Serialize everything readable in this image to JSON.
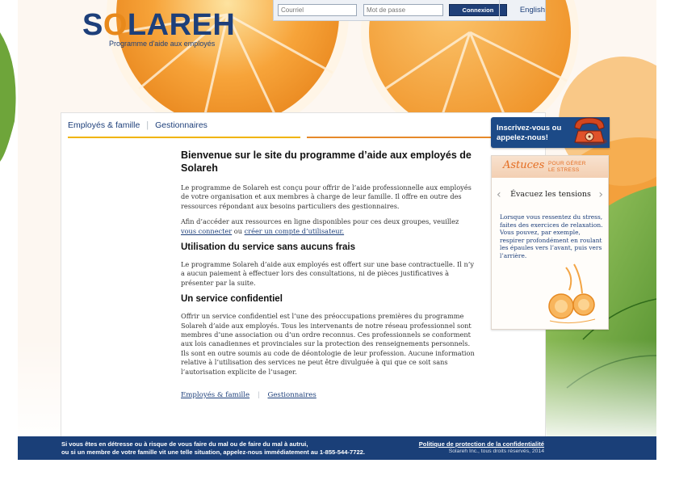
{
  "brand": {
    "logo_name": "SOLAREH",
    "logo_first": "S",
    "logo_o": "O",
    "logo_rest": "LAREH",
    "tagline": "Programme d'aide aux employés"
  },
  "login": {
    "email_placeholder": "Courriel",
    "password_placeholder": "Mot de passe",
    "submit_label": "Connexion",
    "language_label": "English"
  },
  "nav": {
    "items": [
      "Employés & famille",
      "Gestionnaires"
    ]
  },
  "content": {
    "title": "Bienvenue sur le site du programme d’aide aux employés de Solareh",
    "intro": "Le programme de Solareh est conçu pour offrir de l’aide professionnelle aux employés de votre organisation et aux membres à charge de leur famille. Il offre en outre des ressources répondant aux besoins particuliers des gestionnaires.",
    "access_text": "Afin d’accéder aux ressources en ligne disponibles pour ces deux groupes, veuillez",
    "login_link": "vous connecter",
    "or_text": " ou ",
    "register_link": "créer un compte d’utilisateur.",
    "section1_title": "Utilisation du service sans aucuns frais",
    "section1_text": "Le programme Solareh d’aide aux employés est offert sur une base contractuelle. Il n’y a aucun paiement à effectuer lors des consultations, ni de pièces justificatives à présenter par la suite.",
    "section2_title": "Un service confidentiel",
    "section2_text": "Offrir un service confidentiel est l’une des préoccupations premières du programme Solareh d’aide aux employés. Tous les intervenants de notre réseau professionnel sont membres d’une association ou d’un ordre reconnus. Ces professionnels se conforment aux lois canadiennes et provinciales sur la protection des renseignements personnels. Ils sont en outre soumis au code de déontologie de leur profession. Aucune information relative à l’utilisation des services ne peut être divulguée à qui que ce soit sans l’autorisation explicite de l’usager.",
    "bottom_links": [
      "Employés & famille",
      "Gestionnaires"
    ]
  },
  "signup": {
    "label": "Inscrivez-vous ou appelez-nous!",
    "icon": "phone-icon"
  },
  "tips": {
    "script_title": "Astuces",
    "subtitle_line1": "POUR GÉRER",
    "subtitle_line2": "LE STRESS",
    "tip_title": "Évacuez les tensions",
    "tip_text": "Lorsque vous ressentez du stress, faites des exercices de relaxation. Vous pouvez, par exemple, respirer profondément en roulant les épaules vers l’avant, puis vers l’arrière.",
    "prev": "‹",
    "next": "›"
  },
  "footer": {
    "message_line1": "Si vous êtes en détresse ou à risque de vous faire du mal ou de faire du mal à autrui,",
    "message_line2": "ou si un membre de votre famille vit une telle situation, appelez-nous immédiatement au 1-855-544-7722.",
    "policy_link": "Politique de protection de la confidentialité",
    "copyright": "Solareh Inc., tous droits réservés, 2014"
  },
  "colors": {
    "brand_blue": "#1d3f7a",
    "brand_orange": "#e8891b",
    "footer_blue": "#1a3f78"
  }
}
